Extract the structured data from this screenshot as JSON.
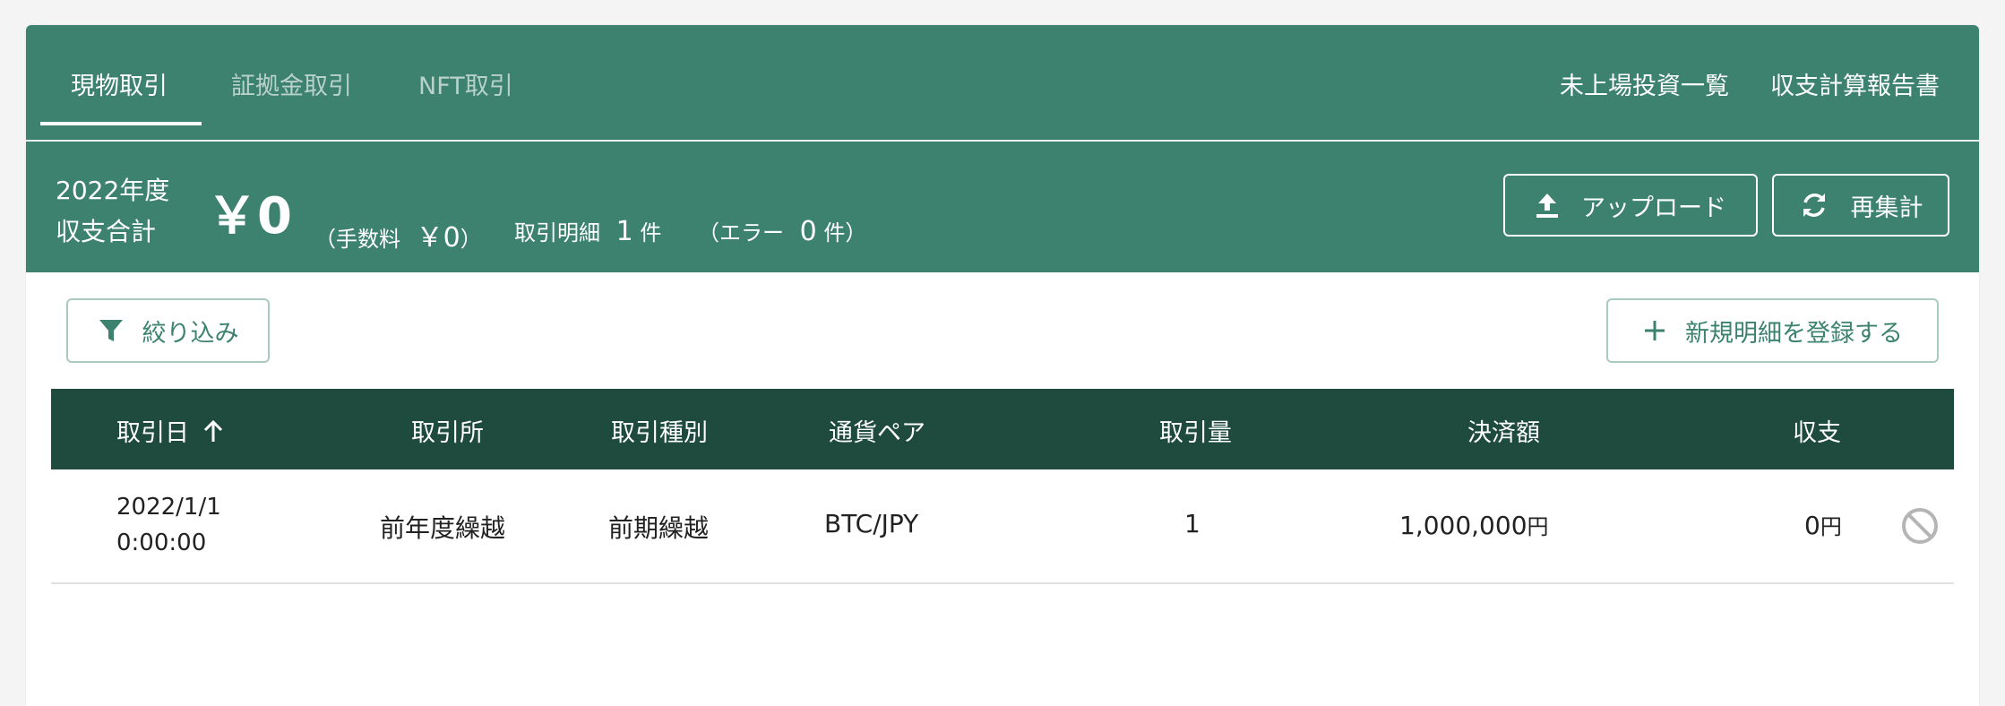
{
  "tabs": [
    {
      "label": "現物取引",
      "active": true
    },
    {
      "label": "証拠金取引",
      "active": false
    },
    {
      "label": "NFT取引",
      "active": false
    }
  ],
  "links": {
    "unlisted": "未上場投資一覧",
    "report": "収支計算報告書"
  },
  "summary": {
    "year": "2022年度",
    "label": "収支合計",
    "total": "￥0",
    "fee_open": "（手数料",
    "fee_value": "￥0",
    "fee_close": "）",
    "count_label": "取引明細",
    "count_value": "1",
    "count_unit": "件",
    "error_open": "（エラー",
    "error_value": "0",
    "error_unit": "件）"
  },
  "buttons": {
    "upload": "アップロード",
    "recalc": "再集計",
    "filter": "絞り込み",
    "add": "新規明細を登録する"
  },
  "table": {
    "headers": {
      "date": "取引日",
      "exchange": "取引所",
      "type": "取引種別",
      "pair": "通貨ペア",
      "amount": "取引量",
      "settlement": "決済額",
      "balance": "収支"
    },
    "rows": [
      {
        "date": "2022/1/1",
        "time": "0:00:00",
        "exchange": "前年度繰越",
        "type": "前期繰越",
        "pair": "BTC/JPY",
        "amount": "1",
        "settlement": "1,000,000",
        "settlement_unit": "円",
        "balance": "0",
        "balance_unit": "円"
      }
    ]
  },
  "colors": {
    "header_green": "#3d826e",
    "table_header": "#1f4b3f",
    "accent": "#3d826e"
  },
  "icons": {
    "upload": "upload-icon",
    "recalc": "refresh-icon",
    "filter": "filter-icon",
    "add": "plus-icon",
    "sort": "arrow-up-icon",
    "row_action": "block-icon"
  }
}
